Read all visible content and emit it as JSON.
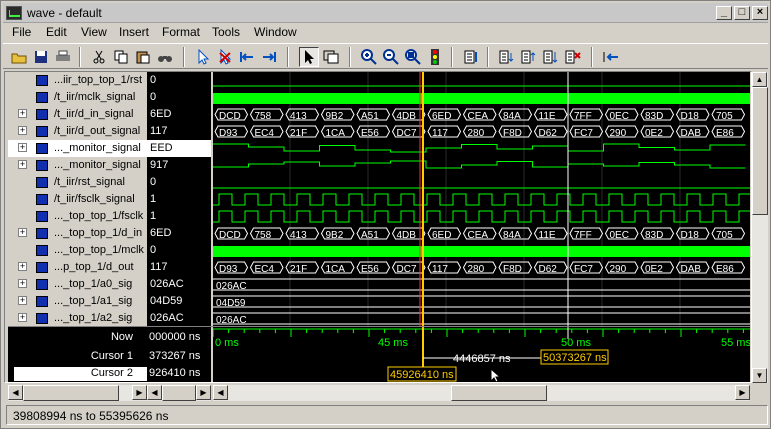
{
  "window": {
    "title": "wave - default",
    "minimize": "_",
    "maximize": "□",
    "close": "×"
  },
  "menu": [
    "File",
    "Edit",
    "View",
    "Insert",
    "Format",
    "Tools",
    "Window"
  ],
  "toolbar_icons": [
    "open-icon",
    "save-icon",
    "print-icon",
    "cut-icon",
    "copy-icon",
    "paste-icon",
    "find-icon",
    "insert-cursor-icon",
    "delete-cursor-icon",
    "find-previous-edge-icon",
    "find-next-edge-icon",
    "select-mode-icon",
    "zoom-mode-icon",
    "zoom-in-icon",
    "zoom-out-icon",
    "zoom-full-icon",
    "stop-sign-icon",
    "goto-icon",
    "expand-icon",
    "collapse-icon",
    "sort-icon",
    "clear-icon",
    "run-icon"
  ],
  "signals": [
    {
      "name": "...iir_top_top_1/rst",
      "value": "0",
      "expandable": false,
      "kind": "bit",
      "selected": false
    },
    {
      "name": "/t_iir/mclk_signal",
      "value": "0",
      "expandable": false,
      "kind": "fastclk",
      "selected": false
    },
    {
      "name": "/t_iir/d_in_signal",
      "value": "6ED",
      "expandable": true,
      "kind": "bus",
      "selected": false
    },
    {
      "name": "/t_iir/d_out_signal",
      "value": "117",
      "expandable": true,
      "kind": "bus",
      "selected": false
    },
    {
      "name": "..._monitor_signal",
      "value": "EED",
      "expandable": true,
      "kind": "analog1",
      "selected": true
    },
    {
      "name": "..._monitor_signal",
      "value": "917",
      "expandable": true,
      "kind": "analog2",
      "selected": false
    },
    {
      "name": "/t_iir/rst_signal",
      "value": "0",
      "expandable": false,
      "kind": "bit",
      "selected": false
    },
    {
      "name": "/t_iir/fsclk_signal",
      "value": "1",
      "expandable": false,
      "kind": "clk",
      "selected": false
    },
    {
      "name": "..._top_top_1/fsclk",
      "value": "1",
      "expandable": false,
      "kind": "clk",
      "selected": false
    },
    {
      "name": "..._top_top_1/d_in",
      "value": "6ED",
      "expandable": true,
      "kind": "bus",
      "selected": false
    },
    {
      "name": "..._top_top_1/mclk",
      "value": "0",
      "expandable": false,
      "kind": "fastclk",
      "selected": false
    },
    {
      "name": "...p_top_1/d_out",
      "value": "117",
      "expandable": true,
      "kind": "bus",
      "selected": false
    },
    {
      "name": "..._top_1/a0_sig",
      "value": "026AC",
      "expandable": true,
      "kind": "const",
      "selected": false
    },
    {
      "name": "..._top_1/a1_sig",
      "value": "04D59",
      "expandable": true,
      "kind": "const",
      "selected": false
    },
    {
      "name": "..._top_1/a2_sig",
      "value": "026AC",
      "expandable": true,
      "kind": "const",
      "selected": false
    }
  ],
  "bus_d_in": [
    "DCD",
    "758",
    "413",
    "9B2",
    "A51",
    "4DB",
    "6ED",
    "CEA",
    "84A",
    "11E",
    "7FF",
    "0EC",
    "83D",
    "D18",
    "705"
  ],
  "bus_d_out": [
    "D93",
    "EC4",
    "21F",
    "1CA",
    "E56",
    "DC7",
    "117",
    "280",
    "F8D",
    "D62",
    "FC7",
    "290",
    "0E2",
    "DAB",
    "E86"
  ],
  "timeline": {
    "now_label": "Now",
    "now_value": "000000 ns",
    "ticks": [
      "0 ms",
      "45 ms",
      "50 ms",
      "55 ms"
    ]
  },
  "cursors": [
    {
      "label": "Cursor 1",
      "value": "373267 ns",
      "delta": "4446857 ns",
      "marker": "50373267 ns"
    },
    {
      "label": "Cursor 2",
      "value": "926410 ns",
      "marker": "45926410 ns"
    }
  ],
  "status": "39808994 ns to 55395626 ns",
  "colors": {
    "wave": "#00ff00",
    "cursor_active": "#ffcc00",
    "cursor_inactive": "#ffffff",
    "background": "#000000"
  }
}
